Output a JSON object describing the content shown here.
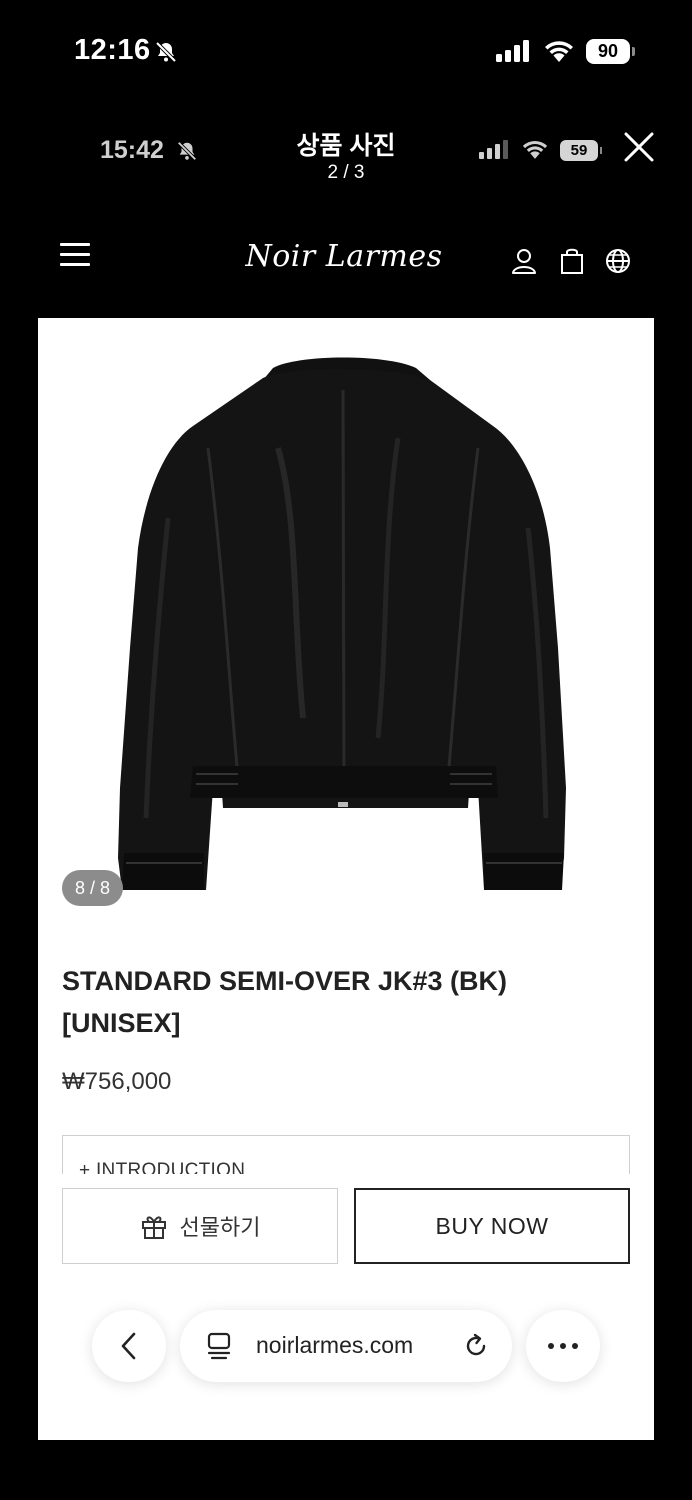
{
  "status_bar": {
    "time": "12:16",
    "battery": "90"
  },
  "viewer": {
    "time": "15:42",
    "title": "상품 사진",
    "counter": "2 / 3",
    "battery": "59"
  },
  "site": {
    "logo": "Noir Larmes"
  },
  "product": {
    "image_counter": "8 / 8",
    "name": "STANDARD SEMI-OVER JK#3 (BK) [UNISEX]",
    "price": "₩756,000",
    "intro_label": "+ INTRODUCTION"
  },
  "actions": {
    "gift_label": "선물하기",
    "buy_label": "BUY NOW"
  },
  "browser": {
    "url": "noirlarmes.com"
  },
  "icons": {
    "bell": "bell-slash-icon",
    "signal": "signal-icon",
    "wifi": "wifi-icon",
    "close": "close-icon",
    "menu": "menu-icon",
    "user": "user-icon",
    "bag": "shopping-bag-icon",
    "globe": "globe-icon",
    "gift": "gift-icon",
    "back": "chevron-left-icon",
    "site": "site-info-icon",
    "reload": "reload-icon",
    "more": "more-icon"
  },
  "colors": {
    "background": "#000000",
    "page": "#ffffff",
    "counter_badge": "#8c8c8c",
    "text": "#222222"
  }
}
